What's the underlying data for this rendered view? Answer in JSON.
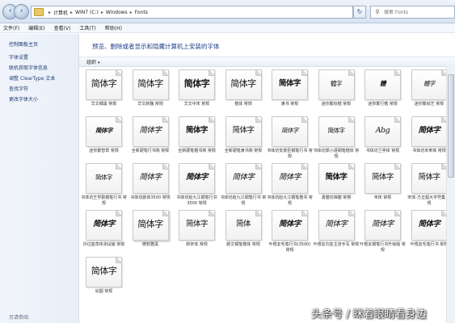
{
  "address_bar": {
    "breadcrumbs": [
      "计算机",
      "WIN7 (C:)",
      "Windows",
      "Fonts"
    ],
    "search_placeholder": "搜索 Fonts"
  },
  "menu": [
    "文件(F)",
    "编辑(E)",
    "查看(V)",
    "工具(T)",
    "帮助(H)"
  ],
  "sidebar": {
    "items": [
      {
        "label": "控制面板主页"
      },
      {
        "label": "字体设置"
      },
      {
        "label": "联机获取字体信息"
      },
      {
        "label": "调整 ClearType 文本"
      },
      {
        "label": "查找字符"
      },
      {
        "label": "更改字体大小"
      }
    ],
    "footer": "另请参阅"
  },
  "main": {
    "heading": "预览、删除或者显示和隐藏计算机上安装的字体",
    "organize_label": "组织"
  },
  "fonts": [
    {
      "preview": "简体字",
      "caption": "华文细黑 常规",
      "style": "large"
    },
    {
      "preview": "简体字",
      "caption": "华文新魏 常规",
      "style": "large serif"
    },
    {
      "preview": "简体字",
      "caption": "华文中宋 常规",
      "style": "large serif bold"
    },
    {
      "preview": "简体字",
      "caption": "楷体 常规",
      "style": "large serif"
    },
    {
      "preview": "简体字",
      "caption": "隶书 常规",
      "style": "mid serif bold"
    },
    {
      "preview": "體字",
      "caption": "迷你繁标楷 常规",
      "style": "small serif"
    },
    {
      "preview": "體",
      "caption": "迷你繁行楷 常规",
      "style": "small italic bold"
    },
    {
      "preview": "體字",
      "caption": "迷你繁综艺 常规",
      "style": "small serif italic"
    },
    {
      "preview": "简体字",
      "caption": "迷你繁智草 常规",
      "style": "small italic bold"
    },
    {
      "preview": "简体字",
      "caption": "全新硬笔行书简 常规",
      "style": "mid italic"
    },
    {
      "preview": "简体字",
      "caption": "全新硬笔楷书简 常规",
      "style": "mid serif bold"
    },
    {
      "preview": "简体字",
      "caption": "全新硬笔隶书简 常规",
      "style": "mid serif"
    },
    {
      "preview": "简体字",
      "caption": "书体坊安景臣钢笔行书 常规",
      "style": "small italic"
    },
    {
      "preview": "简体字",
      "caption": "书体坊郭小语钢笔楷体 常规",
      "style": "small serif"
    },
    {
      "preview": "Abg",
      "caption": "书体坊兰亭体 常规",
      "style": "mid italic serif"
    },
    {
      "preview": "简体字",
      "caption": "书体坊米芾体 常规",
      "style": "mid italic bold"
    },
    {
      "preview": "简体字",
      "caption": "书体坊王学勤钢笔行书 常规",
      "style": "small serif"
    },
    {
      "preview": "简体字",
      "caption": "书体坊颜体3500 常规",
      "style": "mid serif italic"
    },
    {
      "preview": "简体字",
      "caption": "书体坊赵九江钢笔行书3500 常规",
      "style": "mid bold italic"
    },
    {
      "preview": "简体字",
      "caption": "书体坊赵九江钢笔行书 常规",
      "style": "mid serif italic"
    },
    {
      "preview": "简体字",
      "caption": "书体坊赵九江钢笔楷书 常规",
      "style": "mid serif italic"
    },
    {
      "preview": "简体字",
      "caption": "書體坊禪體 常規",
      "style": "mid serif bold"
    },
    {
      "preview": "简体字",
      "caption": "宋体 常规",
      "style": "mid serif"
    },
    {
      "preview": "简体字",
      "caption": "宋体-方正超大字符集 常规",
      "style": "mid serif"
    },
    {
      "preview": "简体字",
      "caption": "孙过庭草体测试版 常规",
      "style": "mid italic bold"
    },
    {
      "preview": "简体字",
      "caption": "微软雅黑",
      "style": "large",
      "stack": true
    },
    {
      "preview": "简体字",
      "caption": "新宋体 常规",
      "style": "mid serif"
    },
    {
      "preview": "简体",
      "caption": "颜文钢笔楷体 常规",
      "style": "mid serif"
    },
    {
      "preview": "简体字",
      "caption": "叶根友毛笔行书(3500) 常规",
      "style": "mid bold italic"
    },
    {
      "preview": "简体字",
      "caption": "叶根友刘友主流手写 常规",
      "style": "mid serif italic"
    },
    {
      "preview": "简体字",
      "caption": "叶根友钢笔行书升级版 常规",
      "style": "mid italic"
    },
    {
      "preview": "简体字",
      "caption": "叶根友毛笔行书 常规",
      "style": "mid bold italic"
    },
    {
      "preview": "简体字",
      "caption": "幼圆 常规",
      "style": "large"
    }
  ],
  "watermark": "头条号 / 眯着眼睛看身边"
}
